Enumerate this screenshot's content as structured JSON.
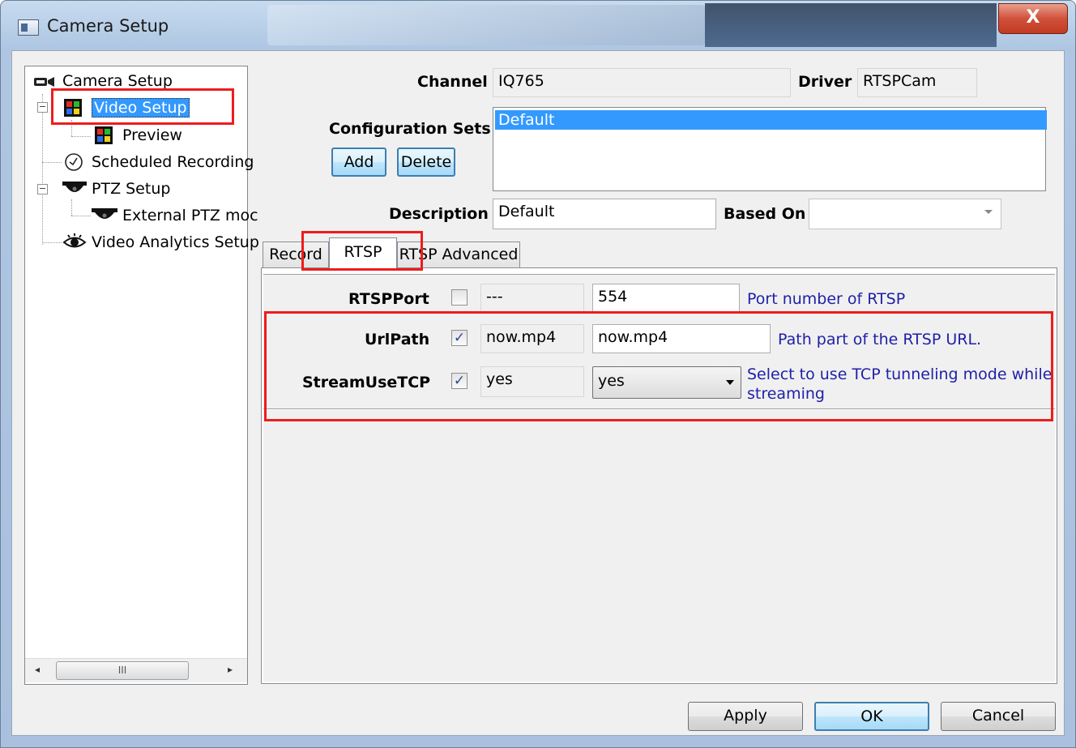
{
  "window": {
    "title": "Camera Setup",
    "close_label": "X"
  },
  "tree": {
    "items": [
      {
        "label": "Camera Setup",
        "icon": "camera-icon"
      },
      {
        "label": "Video Setup",
        "icon": "video-grid-icon"
      },
      {
        "label": "Preview",
        "icon": "video-grid-icon"
      },
      {
        "label": "Scheduled Recording",
        "icon": "clock-icon"
      },
      {
        "label": "PTZ Setup",
        "icon": "dome-camera-icon"
      },
      {
        "label": "External PTZ moc",
        "icon": "dome-camera-icon"
      },
      {
        "label": "Video Analytics Setup",
        "icon": "eye-icon"
      }
    ],
    "scroll_thumb": "III"
  },
  "form": {
    "channel_label": "Channel",
    "channel_value": "IQ765",
    "driver_label": "Driver",
    "driver_value": "RTSPCam",
    "config_sets_label": "Configuration Sets",
    "add_label": "Add",
    "delete_label": "Delete",
    "config_sets": [
      "Default"
    ],
    "description_label": "Description",
    "description_value": "Default",
    "based_on_label": "Based On",
    "based_on_value": ""
  },
  "tabs": [
    {
      "label": "Record"
    },
    {
      "label": "RTSP",
      "active": true
    },
    {
      "label": "RTSP Advanced"
    }
  ],
  "rtsp": {
    "rows": [
      {
        "label": "RTSPPort",
        "checked": false,
        "check_mark": "",
        "current": "---",
        "value": "554",
        "hint": "Port number of RTSP"
      },
      {
        "label": "UrlPath",
        "checked": true,
        "check_mark": "✓",
        "current": "now.mp4",
        "value": "now.mp4",
        "hint": "Path part of the RTSP URL."
      },
      {
        "label": "StreamUseTCP",
        "checked": true,
        "check_mark": "✓",
        "current": "yes",
        "value": "yes",
        "hint_line1": "Select to use TCP tunneling mode while",
        "hint_line2": "streaming"
      }
    ]
  },
  "footer": {
    "apply_label": "Apply",
    "ok_label": "OK",
    "cancel_label": "Cancel"
  },
  "colors": {
    "selection": "#3399ff",
    "hint_text": "#1f1fa8",
    "annotation_red": "#ee1c1c"
  }
}
